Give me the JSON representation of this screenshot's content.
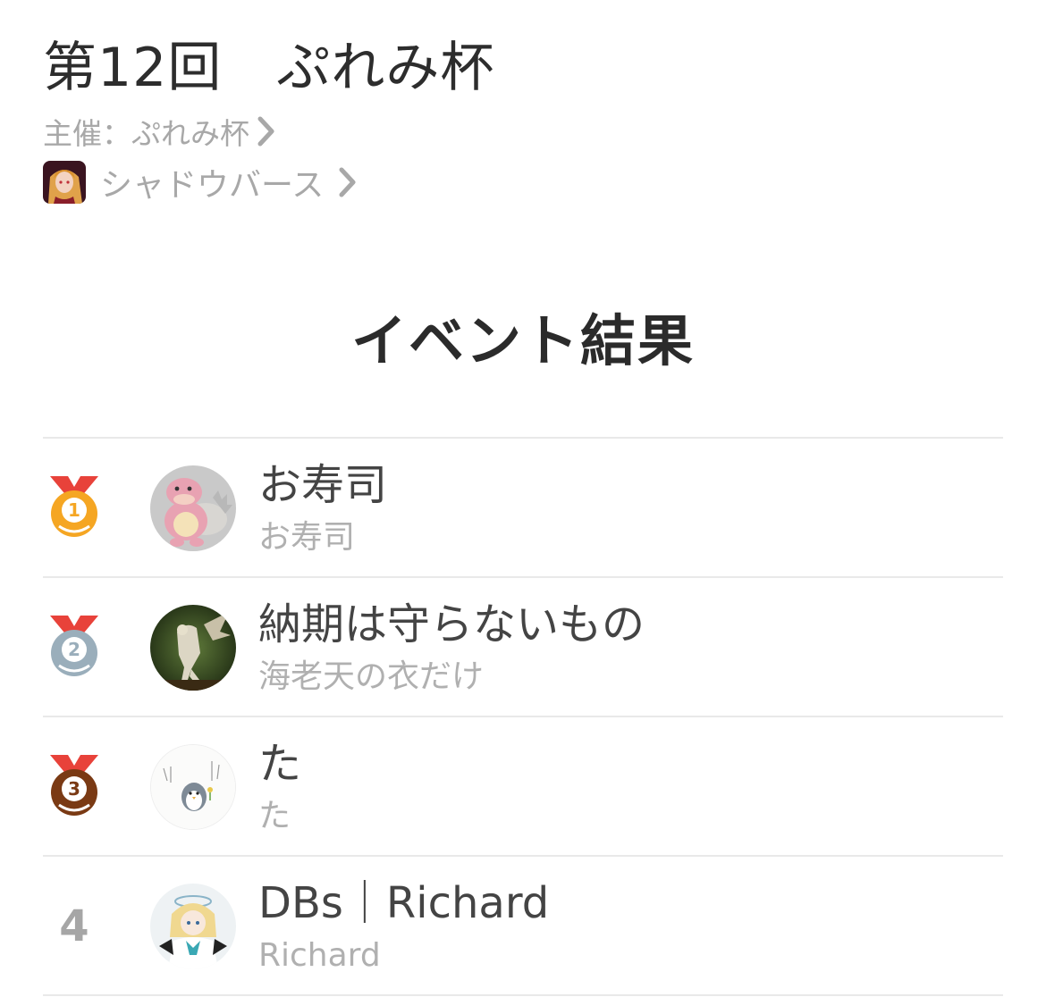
{
  "event": {
    "title": "第12回　ぷれみ杯",
    "organizer_label": "主催：ぷれみ杯",
    "game_name": "シャドウバース",
    "game_icon": "anime-character-app-icon"
  },
  "results": {
    "section_title": "イベント結果",
    "entries": [
      {
        "rank": "1",
        "medal": "gold-medal-icon",
        "name": "お寿司",
        "handle": "お寿司",
        "avatar": "pink-monster-avatar"
      },
      {
        "rank": "2",
        "medal": "silver-medal-icon",
        "name": "納期は守らないもの",
        "handle": "海老天の衣だけ",
        "avatar": "dragon-skeleton-avatar"
      },
      {
        "rank": "3",
        "medal": "bronze-medal-icon",
        "name": "た",
        "handle": "た",
        "avatar": "penguin-sketch-avatar"
      },
      {
        "rank": "4",
        "name": "DBs｜Richard",
        "handle": "Richard",
        "avatar": "anime-girl-avatar"
      }
    ]
  },
  "colors": {
    "gold": "#f5a623",
    "silver": "#9aaebb",
    "bronze": "#7a3a14",
    "ribbon": "#e8423a"
  }
}
